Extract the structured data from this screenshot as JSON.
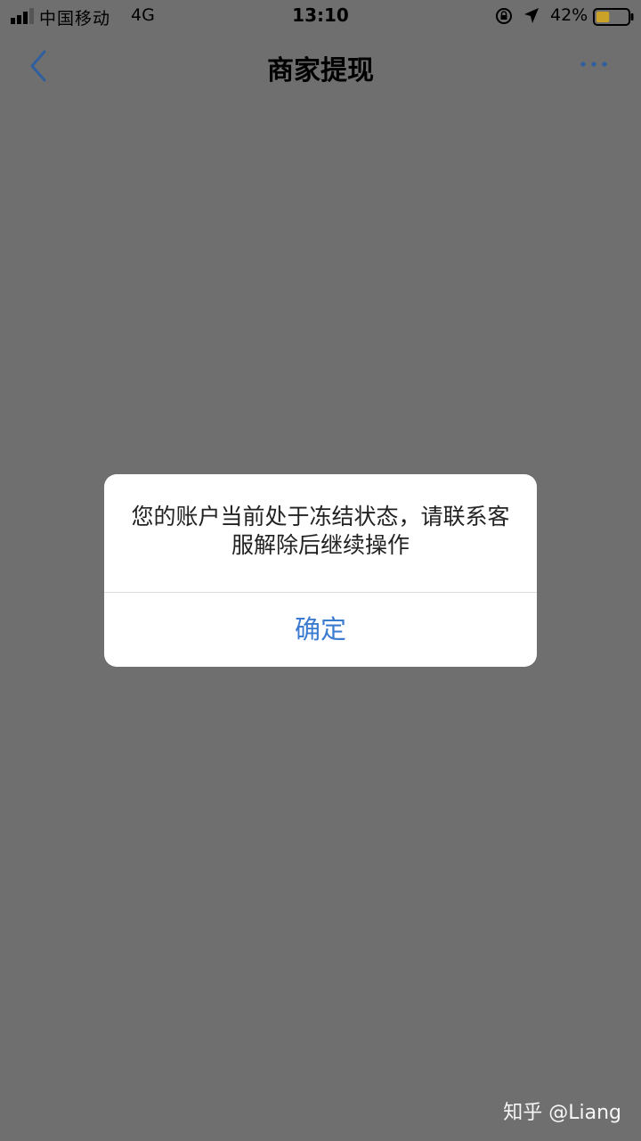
{
  "status_bar": {
    "carrier": "中国移动",
    "network": "4G",
    "time": "13:10",
    "battery_percent": "42%",
    "battery_level": 0.42
  },
  "nav": {
    "title": "商家提现"
  },
  "dialog": {
    "message": "您的账户当前处于冻结状态，请联系客服解除后继续操作",
    "confirm_label": "确定"
  },
  "watermark": {
    "text": "知乎 @Liang"
  },
  "colors": {
    "overlay_bg": "#6f6f6f",
    "accent": "#3b7bd0"
  }
}
